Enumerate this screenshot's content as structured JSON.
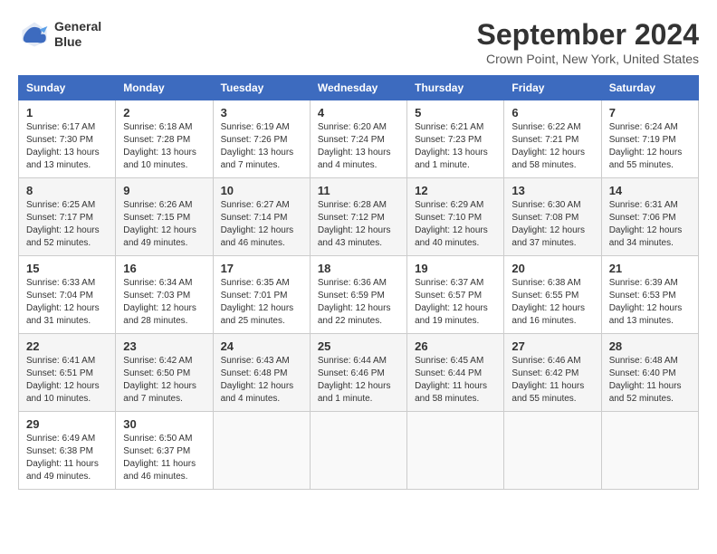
{
  "header": {
    "logo_line1": "General",
    "logo_line2": "Blue",
    "month_title": "September 2024",
    "location": "Crown Point, New York, United States"
  },
  "weekdays": [
    "Sunday",
    "Monday",
    "Tuesday",
    "Wednesday",
    "Thursday",
    "Friday",
    "Saturday"
  ],
  "weeks": [
    [
      {
        "day": "1",
        "info": "Sunrise: 6:17 AM\nSunset: 7:30 PM\nDaylight: 13 hours\nand 13 minutes."
      },
      {
        "day": "2",
        "info": "Sunrise: 6:18 AM\nSunset: 7:28 PM\nDaylight: 13 hours\nand 10 minutes."
      },
      {
        "day": "3",
        "info": "Sunrise: 6:19 AM\nSunset: 7:26 PM\nDaylight: 13 hours\nand 7 minutes."
      },
      {
        "day": "4",
        "info": "Sunrise: 6:20 AM\nSunset: 7:24 PM\nDaylight: 13 hours\nand 4 minutes."
      },
      {
        "day": "5",
        "info": "Sunrise: 6:21 AM\nSunset: 7:23 PM\nDaylight: 13 hours\nand 1 minute."
      },
      {
        "day": "6",
        "info": "Sunrise: 6:22 AM\nSunset: 7:21 PM\nDaylight: 12 hours\nand 58 minutes."
      },
      {
        "day": "7",
        "info": "Sunrise: 6:24 AM\nSunset: 7:19 PM\nDaylight: 12 hours\nand 55 minutes."
      }
    ],
    [
      {
        "day": "8",
        "info": "Sunrise: 6:25 AM\nSunset: 7:17 PM\nDaylight: 12 hours\nand 52 minutes."
      },
      {
        "day": "9",
        "info": "Sunrise: 6:26 AM\nSunset: 7:15 PM\nDaylight: 12 hours\nand 49 minutes."
      },
      {
        "day": "10",
        "info": "Sunrise: 6:27 AM\nSunset: 7:14 PM\nDaylight: 12 hours\nand 46 minutes."
      },
      {
        "day": "11",
        "info": "Sunrise: 6:28 AM\nSunset: 7:12 PM\nDaylight: 12 hours\nand 43 minutes."
      },
      {
        "day": "12",
        "info": "Sunrise: 6:29 AM\nSunset: 7:10 PM\nDaylight: 12 hours\nand 40 minutes."
      },
      {
        "day": "13",
        "info": "Sunrise: 6:30 AM\nSunset: 7:08 PM\nDaylight: 12 hours\nand 37 minutes."
      },
      {
        "day": "14",
        "info": "Sunrise: 6:31 AM\nSunset: 7:06 PM\nDaylight: 12 hours\nand 34 minutes."
      }
    ],
    [
      {
        "day": "15",
        "info": "Sunrise: 6:33 AM\nSunset: 7:04 PM\nDaylight: 12 hours\nand 31 minutes."
      },
      {
        "day": "16",
        "info": "Sunrise: 6:34 AM\nSunset: 7:03 PM\nDaylight: 12 hours\nand 28 minutes."
      },
      {
        "day": "17",
        "info": "Sunrise: 6:35 AM\nSunset: 7:01 PM\nDaylight: 12 hours\nand 25 minutes."
      },
      {
        "day": "18",
        "info": "Sunrise: 6:36 AM\nSunset: 6:59 PM\nDaylight: 12 hours\nand 22 minutes."
      },
      {
        "day": "19",
        "info": "Sunrise: 6:37 AM\nSunset: 6:57 PM\nDaylight: 12 hours\nand 19 minutes."
      },
      {
        "day": "20",
        "info": "Sunrise: 6:38 AM\nSunset: 6:55 PM\nDaylight: 12 hours\nand 16 minutes."
      },
      {
        "day": "21",
        "info": "Sunrise: 6:39 AM\nSunset: 6:53 PM\nDaylight: 12 hours\nand 13 minutes."
      }
    ],
    [
      {
        "day": "22",
        "info": "Sunrise: 6:41 AM\nSunset: 6:51 PM\nDaylight: 12 hours\nand 10 minutes."
      },
      {
        "day": "23",
        "info": "Sunrise: 6:42 AM\nSunset: 6:50 PM\nDaylight: 12 hours\nand 7 minutes."
      },
      {
        "day": "24",
        "info": "Sunrise: 6:43 AM\nSunset: 6:48 PM\nDaylight: 12 hours\nand 4 minutes."
      },
      {
        "day": "25",
        "info": "Sunrise: 6:44 AM\nSunset: 6:46 PM\nDaylight: 12 hours\nand 1 minute."
      },
      {
        "day": "26",
        "info": "Sunrise: 6:45 AM\nSunset: 6:44 PM\nDaylight: 11 hours\nand 58 minutes."
      },
      {
        "day": "27",
        "info": "Sunrise: 6:46 AM\nSunset: 6:42 PM\nDaylight: 11 hours\nand 55 minutes."
      },
      {
        "day": "28",
        "info": "Sunrise: 6:48 AM\nSunset: 6:40 PM\nDaylight: 11 hours\nand 52 minutes."
      }
    ],
    [
      {
        "day": "29",
        "info": "Sunrise: 6:49 AM\nSunset: 6:38 PM\nDaylight: 11 hours\nand 49 minutes."
      },
      {
        "day": "30",
        "info": "Sunrise: 6:50 AM\nSunset: 6:37 PM\nDaylight: 11 hours\nand 46 minutes."
      },
      {
        "day": "",
        "info": ""
      },
      {
        "day": "",
        "info": ""
      },
      {
        "day": "",
        "info": ""
      },
      {
        "day": "",
        "info": ""
      },
      {
        "day": "",
        "info": ""
      }
    ]
  ]
}
